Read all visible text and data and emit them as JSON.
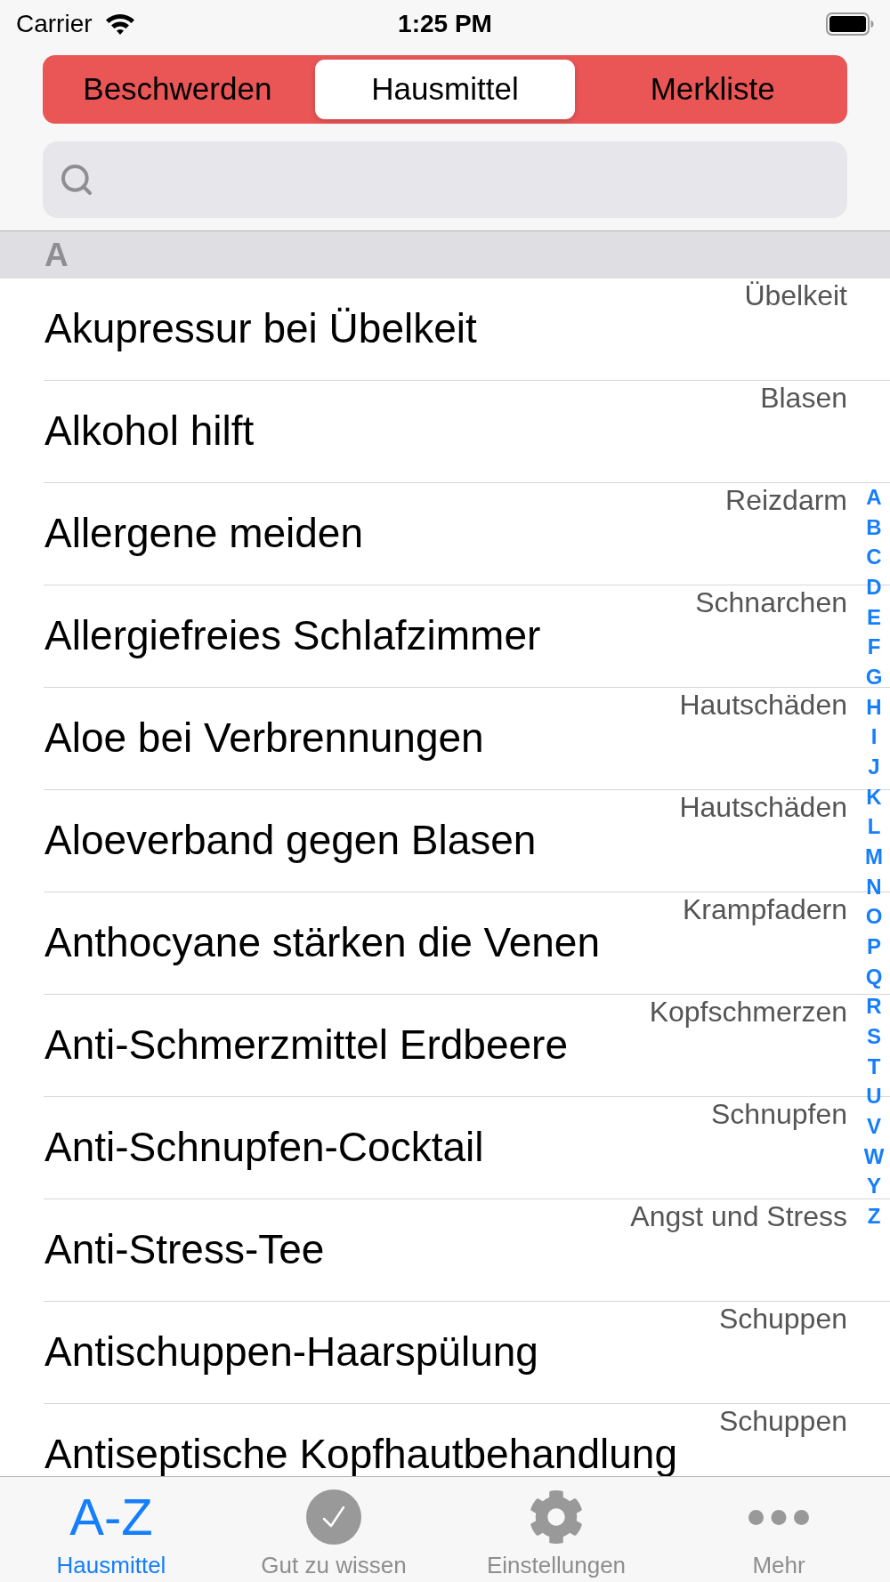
{
  "status_bar": {
    "carrier": "Carrier",
    "time": "1:25 PM"
  },
  "segments": [
    {
      "label": "Beschwerden",
      "selected": false
    },
    {
      "label": "Hausmittel",
      "selected": true
    },
    {
      "label": "Merkliste",
      "selected": false
    }
  ],
  "section": {
    "title": "A"
  },
  "rows": [
    {
      "title": "Akupressur bei Übelkeit",
      "category": "Übelkeit"
    },
    {
      "title": "Alkohol hilft",
      "category": "Blasen"
    },
    {
      "title": "Allergene meiden",
      "category": "Reizdarm"
    },
    {
      "title": "Allergiefreies Schlafzimmer",
      "category": "Schnarchen"
    },
    {
      "title": "Aloe bei Verbrennungen",
      "category": "Hautschäden"
    },
    {
      "title": "Aloeverband gegen Blasen",
      "category": "Hautschäden"
    },
    {
      "title": "Anthocyane stärken die Venen",
      "category": "Krampfadern"
    },
    {
      "title": "Anti-Schmerzmittel Erdbeere",
      "category": "Kopfschmerzen"
    },
    {
      "title": "Anti-Schnupfen-Cocktail",
      "category": "Schnupfen"
    },
    {
      "title": "Anti-Stress-Tee",
      "category": "Angst und Stress"
    },
    {
      "title": "Antischuppen-Haarspülung",
      "category": "Schuppen"
    },
    {
      "title": "Antiseptische Kopfhautbehandlung",
      "category": "Schuppen"
    }
  ],
  "index": [
    "A",
    "B",
    "C",
    "D",
    "E",
    "F",
    "G",
    "H",
    "I",
    "J",
    "K",
    "L",
    "M",
    "N",
    "O",
    "P",
    "Q",
    "R",
    "S",
    "T",
    "U",
    "V",
    "W",
    "Y",
    "Z"
  ],
  "tab_bar": [
    {
      "kind": "text",
      "icon_text": "A-Z",
      "label": "Hausmittel",
      "selected": true
    },
    {
      "kind": "check",
      "label": "Gut zu wissen",
      "selected": false
    },
    {
      "kind": "gear",
      "label": "Einstellungen",
      "selected": false
    },
    {
      "kind": "more",
      "label": "Mehr",
      "selected": false
    }
  ]
}
